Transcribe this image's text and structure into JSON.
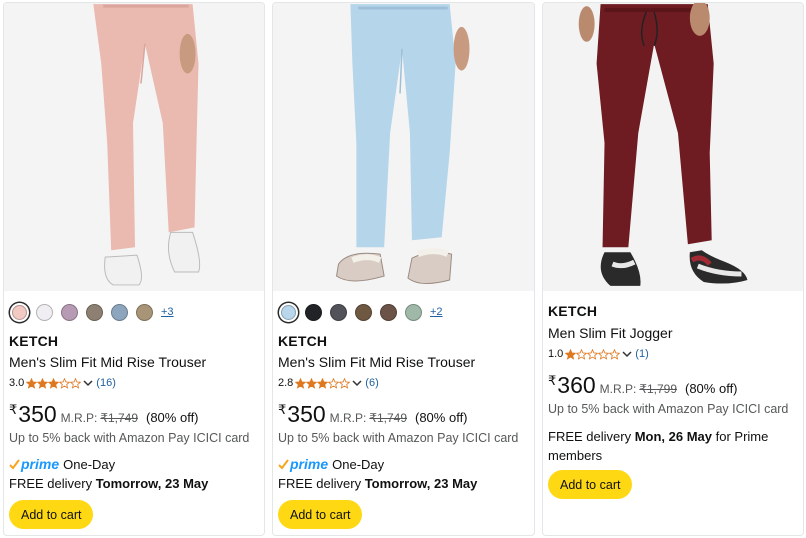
{
  "products": [
    {
      "swatch_colors": [
        "#f3c9c4",
        "#f1eef3",
        "#b79ab3",
        "#8d8072",
        "#8ea6bd",
        "#a89577"
      ],
      "more_colors": "+3",
      "brand": "KETCH",
      "title": "Men's Slim Fit Mid Rise Trouser",
      "rating": "3.0",
      "stars": 3,
      "review_count": "(16)",
      "currency": "₹",
      "price": "350",
      "mrp_label": "M.R.P:",
      "mrp": "₹1,749",
      "discount": "(80% off)",
      "cashback": "Up to 5% back with Amazon Pay ICICI card",
      "prime_label": "prime",
      "prime_speed": "One-Day",
      "delivery_prefix": "FREE delivery",
      "delivery_date": "Tomorrow, 23 May",
      "delivery_suffix": "",
      "cart_label": "Add to cart",
      "pant_color": "#eab9b0"
    },
    {
      "swatch_colors": [
        "#b9d7ec",
        "#222326",
        "#52525a",
        "#6e5842",
        "#6c5347",
        "#9fb8a8"
      ],
      "more_colors": "+2",
      "brand": "KETCH",
      "title": "Men's Slim Fit Mid Rise Trouser",
      "rating": "2.8",
      "stars": 3,
      "review_count": "(6)",
      "currency": "₹",
      "price": "350",
      "mrp_label": "M.R.P:",
      "mrp": "₹1,749",
      "discount": "(80% off)",
      "cashback": "Up to 5% back with Amazon Pay ICICI card",
      "prime_label": "prime",
      "prime_speed": "One-Day",
      "delivery_prefix": "FREE delivery",
      "delivery_date": "Tomorrow, 23 May",
      "delivery_suffix": "",
      "cart_label": "Add to cart",
      "pant_color": "#b5d5ea"
    },
    {
      "brand": "KETCH",
      "title": "Men Slim Fit Jogger",
      "rating": "1.0",
      "stars": 1,
      "review_count": "(1)",
      "currency": "₹",
      "price": "360",
      "mrp_label": "M.R.P:",
      "mrp": "₹1,799",
      "discount": "(80% off)",
      "cashback": "Up to 5% back with Amazon Pay ICICI card",
      "delivery_prefix": "FREE delivery",
      "delivery_date": "Mon, 26 May",
      "delivery_suffix": "for Prime members",
      "cart_label": "Add to cart",
      "pant_color": "#6e1c22"
    }
  ],
  "colors": {
    "star": "#de7921",
    "link": "#2162a1",
    "cart_button": "#ffd814",
    "prime": "#1a98ff"
  }
}
